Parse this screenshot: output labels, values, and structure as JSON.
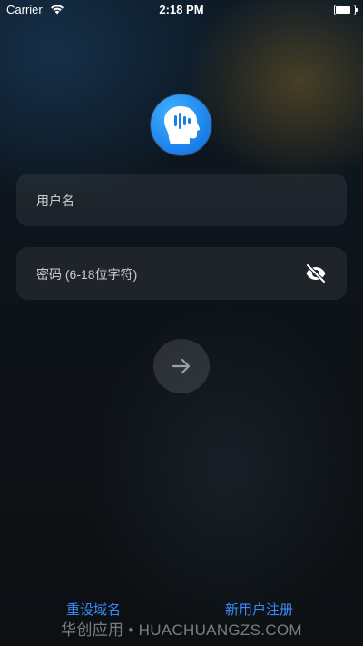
{
  "status_bar": {
    "carrier": "Carrier",
    "time": "2:18 PM",
    "battery_level": 0.9
  },
  "logo": {
    "icon": "head-voice-icon",
    "color": "#1a7ee8"
  },
  "login_form": {
    "username_placeholder": "用户名",
    "password_placeholder": "密码 (6-18位字符)",
    "password_visibility_icon": "eye-slash-icon",
    "submit_icon": "arrow-right-icon"
  },
  "footer": {
    "reset_domain_label": "重设域名",
    "register_label": "新用户注册",
    "link_color": "#3a8dff"
  },
  "watermark": "华创应用 • HUACHUANGZS.COM"
}
